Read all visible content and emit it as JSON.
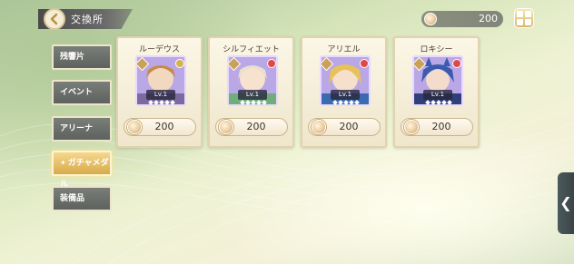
{
  "header": {
    "title": "交換所"
  },
  "currency": {
    "amount": "200"
  },
  "tabs": [
    {
      "label": "残響片",
      "active": false
    },
    {
      "label": "イベント",
      "active": false
    },
    {
      "label": "アリーナ",
      "active": false
    },
    {
      "label": "ガチャメダル",
      "active": true
    },
    {
      "label": "装備品",
      "active": false
    }
  ],
  "cards": [
    {
      "name": "ルーデウス",
      "level": "Lv.1",
      "price": "200",
      "portrait_color": "#c88a4a",
      "badge_color": "#d6b24a"
    },
    {
      "name": "シルフィエット",
      "level": "Lv.1",
      "price": "200",
      "portrait_color": "#d8c9a8",
      "badge_color": "#e04848"
    },
    {
      "name": "アリエル",
      "level": "Lv.1",
      "price": "200",
      "portrait_color": "#e7c25a",
      "badge_color": "#e04848"
    },
    {
      "name": "ロキシー",
      "level": "Lv.1",
      "price": "200",
      "portrait_color": "#3b5bb0",
      "badge_color": "#e04848"
    }
  ]
}
